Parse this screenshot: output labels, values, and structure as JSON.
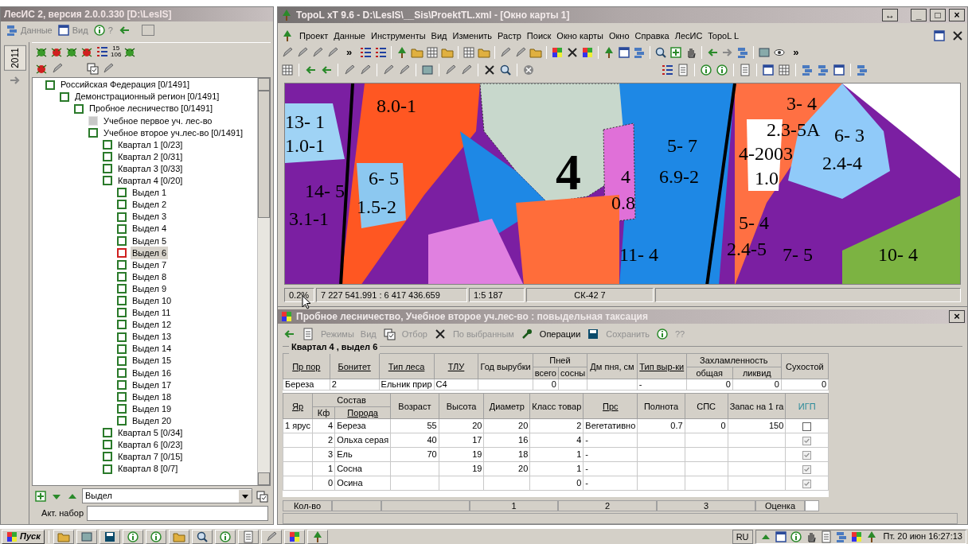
{
  "les_window": {
    "title": "ЛесИС 2, версия 2.0.0.330  [D:\\LesIS]",
    "menu": [
      {
        "label": "Данные",
        "disabled": true
      },
      {
        "label": "Вид",
        "disabled": true
      },
      {
        "label": "?",
        "disabled": true
      }
    ],
    "side_tab": "2011",
    "counter_icon": [
      "15",
      "106"
    ],
    "tree": [
      {
        "label": "Российская Федерация [0/1491]",
        "disabled": false,
        "selected": false,
        "children": [
          {
            "label": "Демонстрационный  регион [0/1491]",
            "disabled": false,
            "selected": false,
            "children": [
              {
                "label": "Пробное лесничество [0/1491]",
                "disabled": false,
                "selected": false,
                "children": [
                  {
                    "label": "Учебное первое уч. лес-во",
                    "disabled": true,
                    "selected": false
                  },
                  {
                    "label": "Учебное второе уч.лес-во [0/1491]",
                    "disabled": false,
                    "selected": false,
                    "children": [
                      {
                        "label": "Квартал 1 [0/23]",
                        "disabled": false,
                        "selected": false
                      },
                      {
                        "label": "Квартал 2 [0/31]",
                        "disabled": false,
                        "selected": false
                      },
                      {
                        "label": "Квартал 3 [0/33]",
                        "disabled": false,
                        "selected": false
                      },
                      {
                        "label": "Квартал 4 [0/20]",
                        "disabled": false,
                        "selected": false,
                        "children": [
                          {
                            "label": "Выдел 1",
                            "disabled": false,
                            "selected": false
                          },
                          {
                            "label": "Выдел 2",
                            "disabled": false,
                            "selected": false
                          },
                          {
                            "label": "Выдел 3",
                            "disabled": false,
                            "selected": false
                          },
                          {
                            "label": "Выдел 4",
                            "disabled": false,
                            "selected": false
                          },
                          {
                            "label": "Выдел 5",
                            "disabled": false,
                            "selected": false
                          },
                          {
                            "label": "Выдел 6",
                            "disabled": false,
                            "selected": true
                          },
                          {
                            "label": "Выдел 7",
                            "disabled": false,
                            "selected": false
                          },
                          {
                            "label": "Выдел 8",
                            "disabled": false,
                            "selected": false
                          },
                          {
                            "label": "Выдел 9",
                            "disabled": false,
                            "selected": false
                          },
                          {
                            "label": "Выдел 10",
                            "disabled": false,
                            "selected": false
                          },
                          {
                            "label": "Выдел 11",
                            "disabled": false,
                            "selected": false
                          },
                          {
                            "label": "Выдел 12",
                            "disabled": false,
                            "selected": false
                          },
                          {
                            "label": "Выдел 13",
                            "disabled": false,
                            "selected": false
                          },
                          {
                            "label": "Выдел 14",
                            "disabled": false,
                            "selected": false
                          },
                          {
                            "label": "Выдел 15",
                            "disabled": false,
                            "selected": false
                          },
                          {
                            "label": "Выдел 16",
                            "disabled": false,
                            "selected": false
                          },
                          {
                            "label": "Выдел 17",
                            "disabled": false,
                            "selected": false
                          },
                          {
                            "label": "Выдел 18",
                            "disabled": false,
                            "selected": false
                          },
                          {
                            "label": "Выдел 19",
                            "disabled": false,
                            "selected": false
                          },
                          {
                            "label": "Выдел 20",
                            "disabled": false,
                            "selected": false
                          }
                        ]
                      },
                      {
                        "label": "Квартал 5 [0/34]",
                        "disabled": false,
                        "selected": false
                      },
                      {
                        "label": "Квартал 6 [0/23]",
                        "disabled": false,
                        "selected": false
                      },
                      {
                        "label": "Квартал 7 [0/15]",
                        "disabled": false,
                        "selected": false
                      },
                      {
                        "label": "Квартал 8 [0/7]",
                        "disabled": false,
                        "selected": false
                      }
                    ]
                  }
                ]
              }
            ]
          }
        ]
      }
    ],
    "level_select": {
      "value": "Выдел"
    },
    "active_set": {
      "label": "Акт. набор"
    }
  },
  "map_window": {
    "title": "TopoL xT 9.6 - D:\\LesIS\\__Sis\\ProektTL.xml - [Окно карты 1]",
    "title_buttons": [
      "↔",
      "_",
      "□",
      "×"
    ],
    "menu": [
      "Проект",
      "Данные",
      "Инструменты",
      "Вид",
      "Изменить",
      "Растр",
      "Поиск",
      "Окно карты",
      "Окно",
      "Справка",
      "ЛесИС",
      "TopoL L"
    ],
    "toolbar_chevrons": [
      "»",
      "»"
    ],
    "map": {
      "labels": [
        "3- 4",
        "8.0-1",
        "13- 1",
        "2.3-5A",
        "6- 3",
        "1.0-1",
        "5- 7",
        "4-2003",
        "4",
        "2.4-4",
        "6- 5",
        "4",
        "6.9-2",
        "1.0",
        "14- 5",
        "0.8",
        "1.5-2",
        "3.1-1",
        "5- 4",
        "2.4-5",
        "11- 4",
        "7- 5",
        "10- 4"
      ]
    },
    "status_bar": [
      "0.2%",
      "7 227 541.991 : 6 417 436.659",
      "1:5 187",
      "СК-42 7"
    ]
  },
  "taxation_window": {
    "title": "Пробное лесничество, Учебное второе уч.лес-во : повыдельная таксация",
    "close": "×",
    "toolbar": [
      {
        "label": "Режимы",
        "disabled": true
      },
      {
        "label": "Вид",
        "disabled": true
      },
      {
        "label": "Отбор",
        "disabled": true
      },
      {
        "label": "По выбранным",
        "disabled": true
      },
      {
        "label": "Операции",
        "disabled": false
      },
      {
        "label": "Сохранить",
        "disabled": true
      },
      {
        "label": "??",
        "disabled": true
      }
    ],
    "group_title": "Квартал 4 , выдел 6",
    "stand_table": {
      "columns": [
        {
          "label": "Пр пор",
          "underlined": true
        },
        {
          "label": "Бонитет",
          "underlined": true
        },
        {
          "label": "Тип леса",
          "underlined": true
        },
        {
          "label": "ТЛУ",
          "underlined": true
        },
        {
          "label": "Год вырубки",
          "underlined": false
        },
        {
          "label": "Пней",
          "underlined": false,
          "colspan": 2,
          "children": [
            {
              "label": "всего",
              "underlined": false
            },
            {
              "label": "сосны",
              "underlined": false
            }
          ]
        },
        {
          "label": "Дм пня, см",
          "underlined": false
        },
        {
          "label": "Тип выр-ки",
          "underlined": true
        },
        {
          "label": "Захламленность",
          "underlined": false,
          "colspan": 2,
          "children": [
            {
              "label": "общая",
              "underlined": false
            },
            {
              "label": "ликвид",
              "underlined": false
            }
          ]
        },
        {
          "label": "Сухостой",
          "underlined": false
        }
      ],
      "rows": [
        [
          "Береза",
          "2",
          "Ельник прир",
          "С4",
          "",
          "0",
          "",
          "",
          "-",
          "0",
          "0",
          "0"
        ]
      ]
    },
    "composition_table": {
      "columns": [
        {
          "label": "Яр",
          "underlined": true
        },
        {
          "label": "Состав",
          "underlined": false,
          "colspan": 2,
          "children": [
            {
              "label": "Кф",
              "underlined": false
            },
            {
              "label": "Порода",
              "underlined": true
            }
          ]
        },
        {
          "label": "Возраст",
          "underlined": false
        },
        {
          "label": "Высота",
          "underlined": false
        },
        {
          "label": "Диаметр",
          "underlined": false
        },
        {
          "label": "Класс товар",
          "underlined": false
        },
        {
          "label": "Прс",
          "underlined": true
        },
        {
          "label": "Полнота",
          "underlined": false
        },
        {
          "label": "СПС",
          "underlined": false
        },
        {
          "label": "Запас на 1 га",
          "underlined": false
        },
        {
          "label": "ИГП",
          "underlined": false
        }
      ],
      "rows": [
        {
          "cells": [
            "1 ярус",
            "4",
            "Береза",
            "55",
            "20",
            "20",
            "2",
            "Вегетативно",
            "0.7",
            "0",
            "150"
          ],
          "igp_checked": false
        },
        {
          "cells": [
            "",
            "2",
            "Ольха серая",
            "40",
            "17",
            "16",
            "4",
            "-",
            "",
            "",
            ""
          ],
          "igp_checked": true
        },
        {
          "cells": [
            "",
            "3",
            "Ель",
            "70",
            "19",
            "18",
            "1",
            "-",
            "",
            "",
            ""
          ],
          "igp_checked": true
        },
        {
          "cells": [
            "",
            "1",
            "Сосна",
            "",
            "19",
            "20",
            "1",
            "-",
            "",
            "",
            ""
          ],
          "igp_checked": true
        },
        {
          "cells": [
            "",
            "0",
            "Осина",
            "",
            "",
            "",
            "0",
            "-",
            "",
            "",
            ""
          ],
          "igp_checked": true
        }
      ]
    },
    "summary_row": [
      "Кол-во",
      "1",
      "2",
      "3",
      "Оценка"
    ]
  },
  "taskbar": {
    "start": "Пуск",
    "language": "RU",
    "clock": "Пт. 20 июн 16:27:13"
  }
}
